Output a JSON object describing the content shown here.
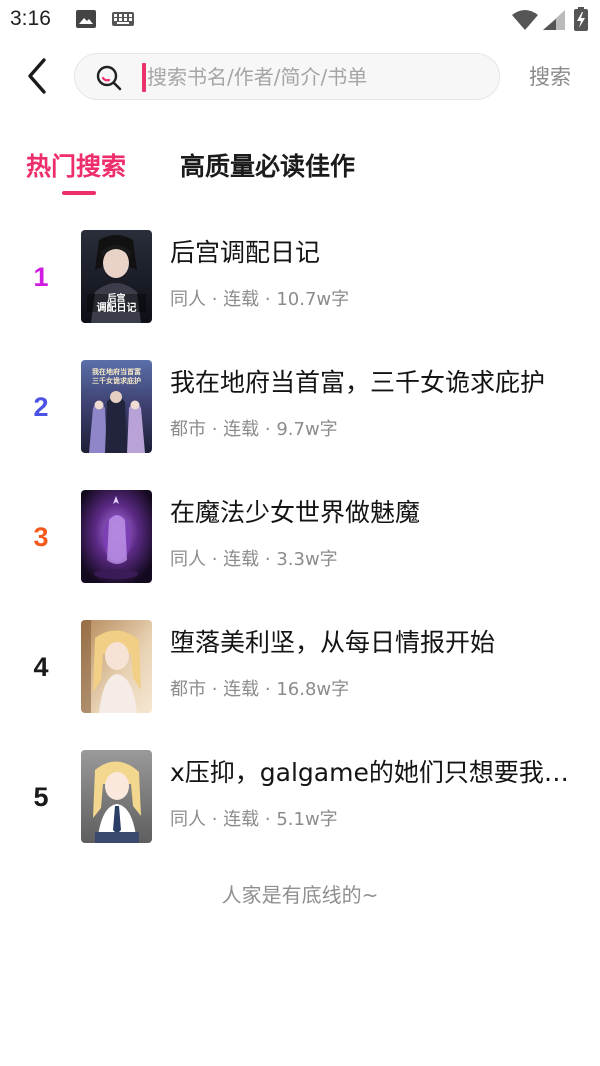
{
  "status_bar": {
    "time": "3:16",
    "icons": [
      "gallery-icon",
      "keyboard-icon",
      "wifi-icon",
      "signal-icon",
      "battery-icon"
    ]
  },
  "header": {
    "back_icon": "chevron-left-icon",
    "search_placeholder": "搜索书名/作者/简介/书单",
    "search_value": "",
    "search_button": "搜索"
  },
  "tabs": [
    {
      "label": "热门搜索",
      "active": true
    },
    {
      "label": "高质量必读佳作",
      "active": false
    }
  ],
  "books": [
    {
      "rank": "1",
      "rank_color": "#cf1ce0",
      "title": "后宫调配日记",
      "meta": "同人 · 连载 · 10.7w字",
      "cover_text": "后宫调配日记"
    },
    {
      "rank": "2",
      "rank_color": "#4d52e6",
      "title": "我在地府当首富，三千女诡求庇护",
      "meta": "都市 · 连载 · 9.7w字",
      "cover_text": "我在地府当首富三千女诡求庇护"
    },
    {
      "rank": "3",
      "rank_color": "#f45a1c",
      "title": "在魔法少女世界做魅魔",
      "meta": "同人 · 连载 · 3.3w字",
      "cover_text": ""
    },
    {
      "rank": "4",
      "rank_color": "#1a1a1a",
      "title": "堕落美利坚，从每日情报开始",
      "meta": "都市 · 连载 · 16.8w字",
      "cover_text": ""
    },
    {
      "rank": "5",
      "rank_color": "#1a1a1a",
      "title": "x压抑，galgame的她们只想要我…",
      "meta": "同人 · 连载 · 5.1w字",
      "cover_text": ""
    }
  ],
  "footer": "人家是有底线的~",
  "colors": {
    "accent": "#ee2e6a",
    "meta": "#8c8c8c"
  }
}
